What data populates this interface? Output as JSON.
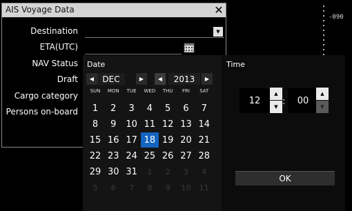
{
  "window": {
    "title": "AIS Voyage Data"
  },
  "scale": {
    "label": "-090"
  },
  "fields": {
    "destination": "Destination",
    "eta": "ETA(UTC)",
    "nav_status": "NAV Status",
    "draft": "Draft",
    "cargo_category": "Cargo category",
    "persons_on_board": "Persons on-board"
  },
  "date_picker": {
    "title": "Date",
    "month": "DEC",
    "year": "2013",
    "weekdays": [
      "SUN",
      "MON",
      "TUE",
      "WED",
      "THU",
      "FRI",
      "SAT"
    ],
    "weeks": [
      [
        "1",
        "2",
        "3",
        "4",
        "5",
        "6",
        "7"
      ],
      [
        "8",
        "9",
        "10",
        "11",
        "12",
        "13",
        "14"
      ],
      [
        "15",
        "16",
        "17",
        "18",
        "19",
        "20",
        "21"
      ],
      [
        "22",
        "23",
        "24",
        "25",
        "26",
        "27",
        "28"
      ],
      [
        "29",
        "30",
        "31",
        "1",
        "2",
        "3",
        "4"
      ],
      [
        "5",
        "6",
        "7",
        "8",
        "9",
        "10",
        "11"
      ]
    ],
    "selected_day": "18"
  },
  "time_picker": {
    "title": "Time",
    "hour": "12",
    "minute": "00",
    "separator": ":",
    "ok_label": "OK"
  }
}
